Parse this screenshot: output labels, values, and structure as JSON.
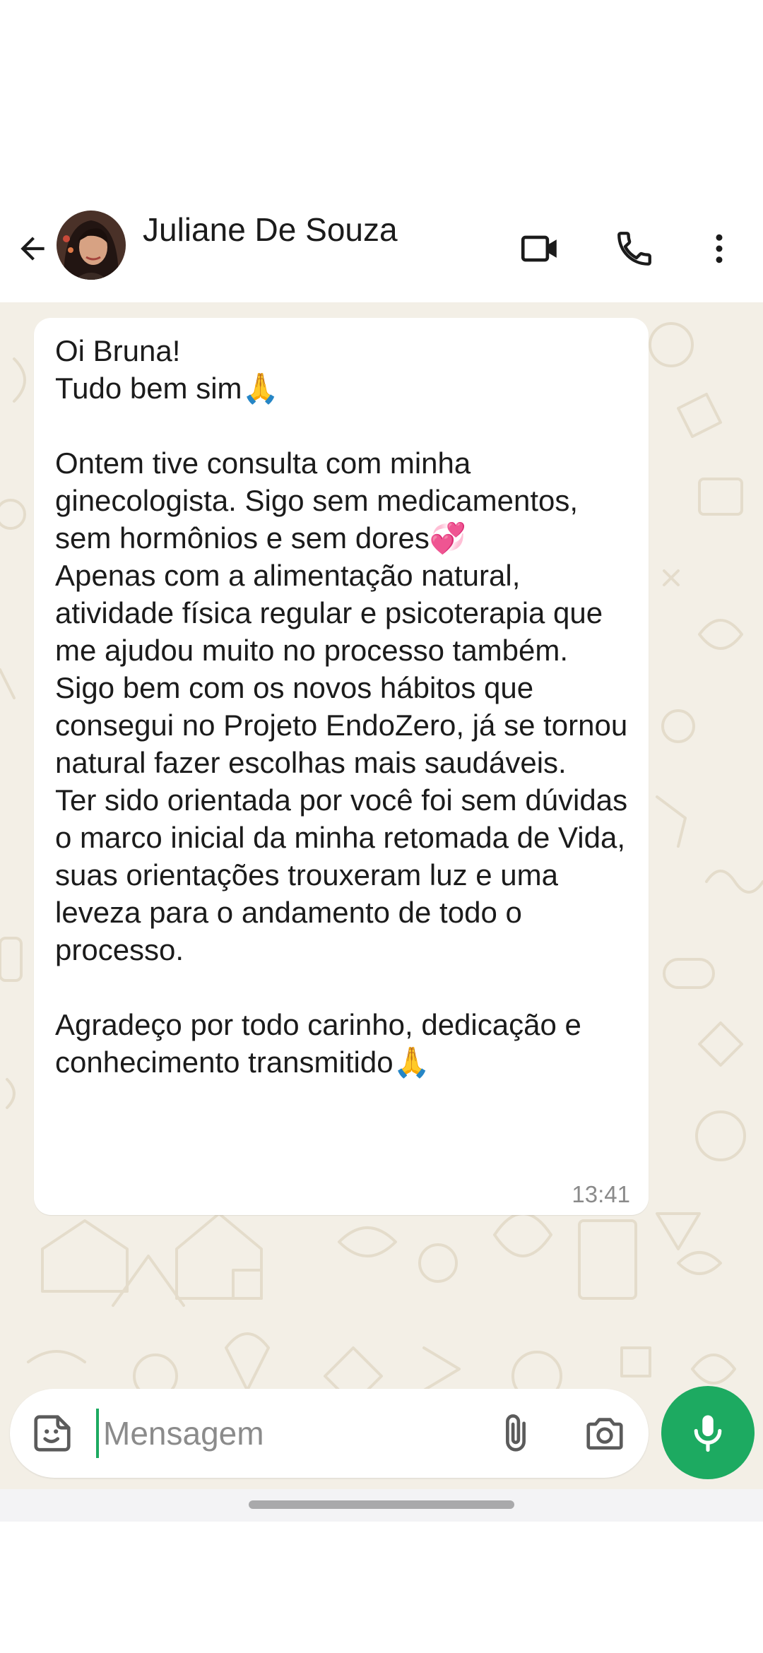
{
  "header": {
    "contact_name": "Juliane De Souza",
    "back_icon": "arrow-back-icon",
    "video_icon": "video-call-icon",
    "call_icon": "phone-call-icon",
    "menu_icon": "more-vertical-icon"
  },
  "message": {
    "text": "Oi Bruna!\nTudo bem sim🙏\n\nOntem tive consulta com minha ginecologista. Sigo sem medicamentos, sem hormônios e sem dores💞\nApenas com a alimentação natural, atividade física regular e psicoterapia que me ajudou muito no processo também.\nSigo bem com os novos hábitos que consegui no Projeto EndoZero, já se tornou natural fazer escolhas mais saudáveis.\nTer sido orientada por você foi sem dúvidas o marco inicial da minha retomada de Vida, suas orientações trouxeram luz e uma leveza para o andamento de todo o processo.\n\nAgradeço por todo carinho, dedicação e conhecimento transmitido🙏",
    "time": "13:41"
  },
  "composer": {
    "placeholder": "Mensagem",
    "sticker_icon": "sticker-icon",
    "attach_icon": "paperclip-icon",
    "camera_icon": "camera-icon",
    "mic_icon": "microphone-icon"
  },
  "colors": {
    "accent": "#1daa61",
    "chat_background": "#f3efe6",
    "bubble": "#ffffff"
  }
}
